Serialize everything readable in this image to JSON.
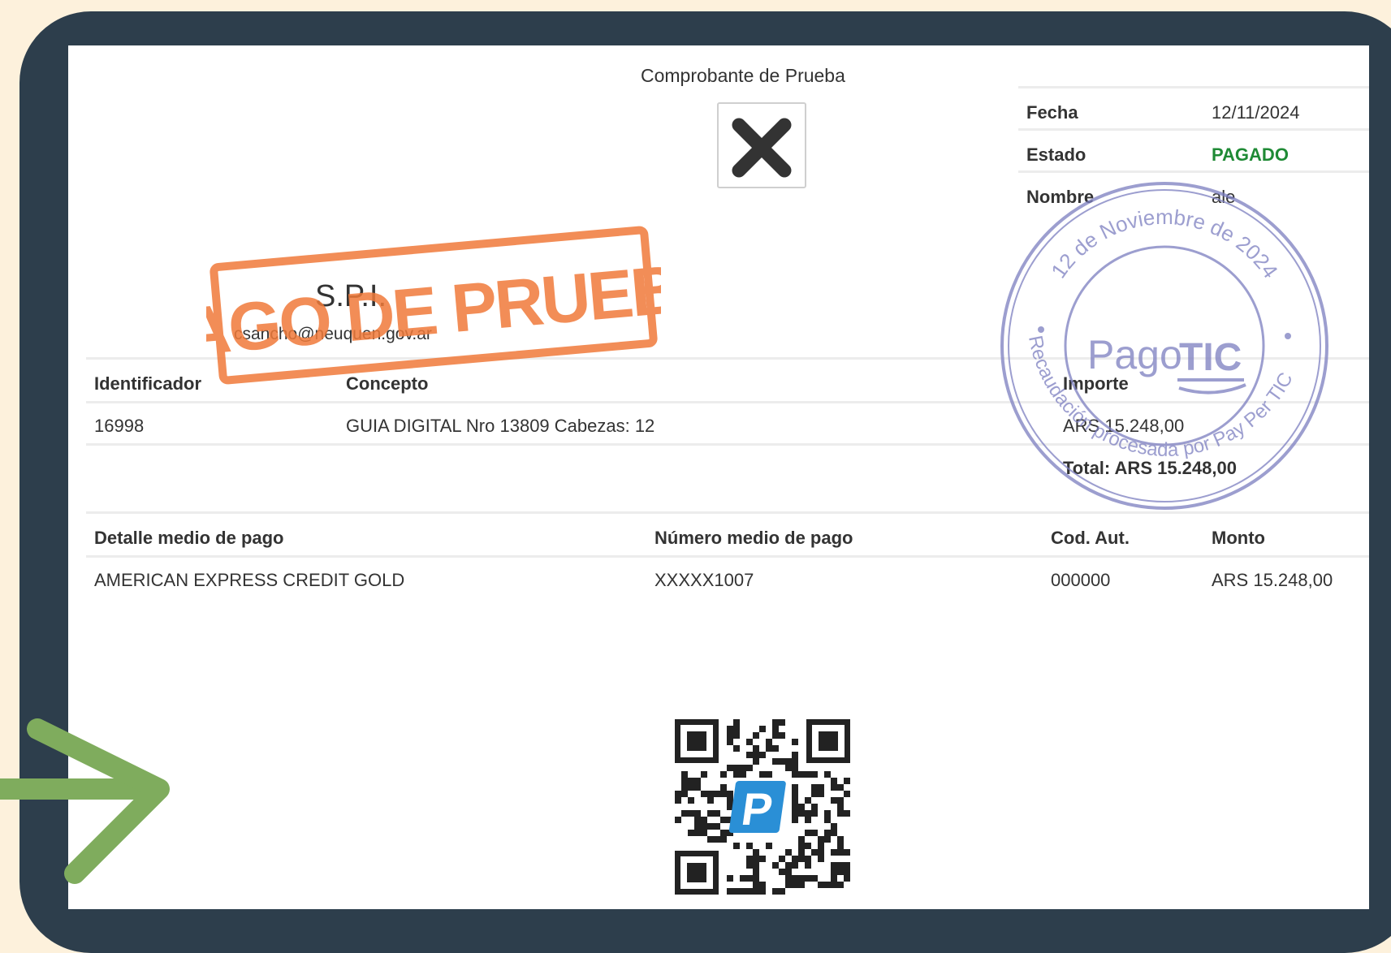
{
  "receipt": {
    "title": "Comprobante de Prueba",
    "info": [
      {
        "label": "Fecha",
        "value": "12/11/2024"
      },
      {
        "label": "Estado",
        "value": "PAGADO"
      },
      {
        "label": "Nombre",
        "value": "ale"
      }
    ],
    "org": {
      "name": "S.P.I.",
      "email": "csancho@neuquen.gov.ar"
    },
    "items_table": {
      "headers": [
        "Identificador",
        "Concepto",
        "Importe"
      ],
      "rows": [
        [
          "16998",
          "GUIA DIGITAL Nro 13809 Cabezas: 12",
          "ARS 15.248,00"
        ]
      ],
      "total": "Total: ARS 15.248,00"
    },
    "payment_table": {
      "headers": [
        "Detalle medio de pago",
        "Número medio de pago",
        "Cod. Aut.",
        "Monto"
      ],
      "rows": [
        [
          "AMERICAN EXPRESS CREDIT GOLD",
          "XXXXX1007",
          "000000",
          "ARS 15.248,00"
        ]
      ]
    },
    "stamps": {
      "red": "PAGO DE PRUEBA",
      "seal_top": "12 de Noviembre de 2024",
      "seal_center_a": "Pago",
      "seal_center_b": "TIC",
      "seal_bottom": "Recaudación procesada por Pay Per TIC"
    },
    "qr_logo_letter": "P"
  },
  "icons": {
    "close": "close-icon",
    "arrow": "arrow-right-icon",
    "qr": "qr-code-icon"
  },
  "colors": {
    "frame": "#2d3e4c",
    "background": "#fdf1dc",
    "status_paid": "#1f8a35",
    "stamp_red": "#f07a3a",
    "seal_blue": "#7c7ec0",
    "arrow_green": "#7fac5d",
    "qr_logo": "#2a8fd6"
  }
}
